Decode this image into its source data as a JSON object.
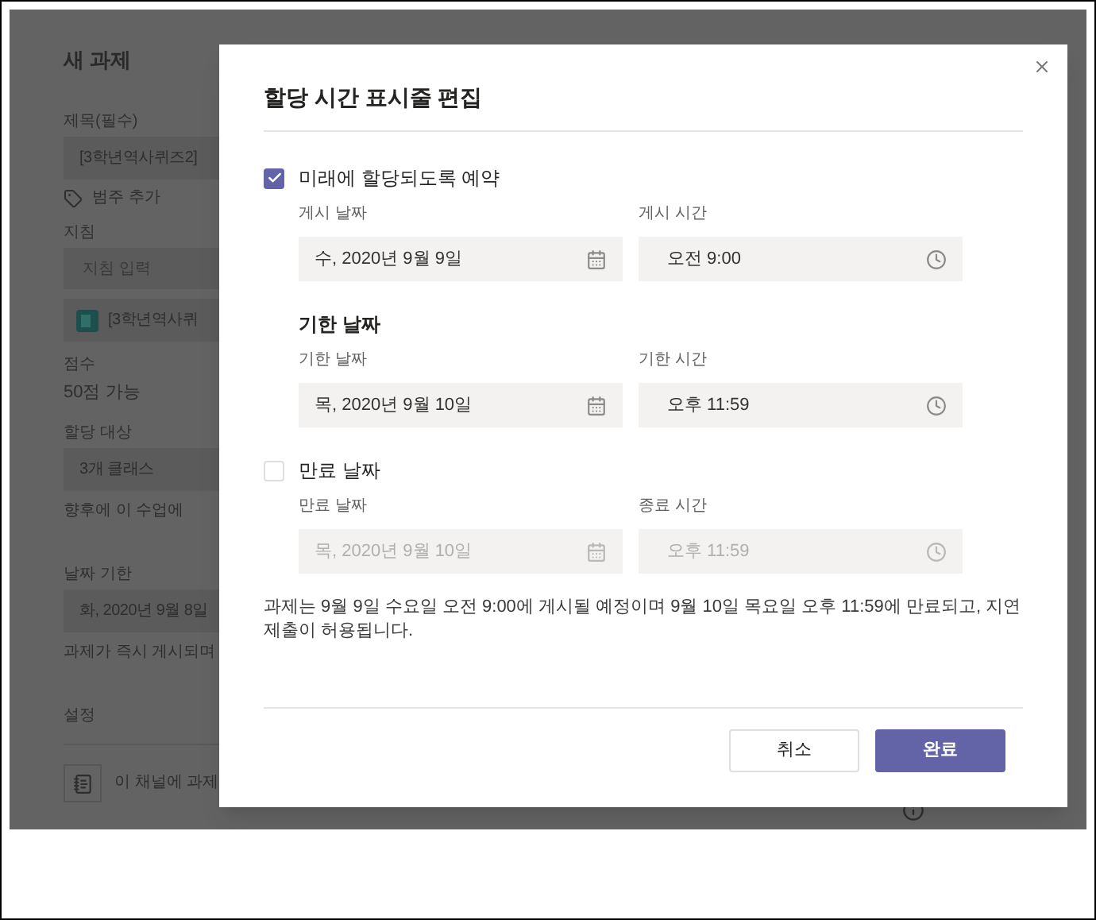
{
  "background": {
    "items": [
      {
        "kind": "heading",
        "text": "새 과제"
      },
      {
        "kind": "label",
        "text": "제목(필수)"
      },
      {
        "kind": "field",
        "text": "[3학년역사퀴즈2]"
      },
      {
        "kind": "tag",
        "text": "범주 추가"
      },
      {
        "kind": "label",
        "text": "지침"
      },
      {
        "kind": "hint",
        "placeholder": "지침 입력"
      },
      {
        "kind": "attachment",
        "text": "[3학년역사퀴"
      },
      {
        "kind": "label",
        "text": "점수"
      },
      {
        "kind": "value",
        "text": "50점 가능"
      },
      {
        "kind": "label",
        "text": "할당 대상"
      },
      {
        "kind": "field",
        "text": "3개 클래스"
      },
      {
        "kind": "note",
        "text": "향후에 이 수업에"
      },
      {
        "kind": "label",
        "text": "날짜 기한"
      },
      {
        "kind": "field",
        "text": "화, 2020년 9월 8일"
      },
      {
        "kind": "note",
        "text": "과제가 즉시 게시되며"
      },
      {
        "kind": "label",
        "text": "설정"
      },
      {
        "kind": "setting",
        "text": "이 채널에 과제"
      }
    ]
  },
  "dialog": {
    "title": "할당 시간 표시줄 편집",
    "sections": [
      {
        "kind": "checkbox",
        "title": "미래에 할당되도록 예약",
        "checked": true,
        "fields": [
          {
            "kind": "date",
            "label": "게시 날짜",
            "value": "수, 2020년 9월 9일",
            "disabled": false
          },
          {
            "kind": "time",
            "label": "게시 시간",
            "value": "오전 9:00",
            "disabled": false
          }
        ]
      },
      {
        "kind": "heading",
        "title": "기한 날짜",
        "fields": [
          {
            "kind": "date",
            "label": "기한 날짜",
            "value": "목, 2020년 9월 10일",
            "disabled": false
          },
          {
            "kind": "time",
            "label": "기한 시간",
            "value": "오후 11:59",
            "disabled": false
          }
        ]
      },
      {
        "kind": "checkbox",
        "title": "만료 날짜",
        "checked": false,
        "fields": [
          {
            "kind": "date",
            "label": "만료 날짜",
            "value": "목, 2020년 9월 10일",
            "disabled": true
          },
          {
            "kind": "time",
            "label": "종료 시간",
            "value": "오후 11:59",
            "disabled": true
          }
        ]
      }
    ],
    "summary": "과제는 9월 9일 수요일 오전 9:00에 게시될 예정이며 9월 10일 목요일 오후 11:59에 만료되고, 지연 제출이 허용됩니다.",
    "buttons": [
      {
        "kind": "secondary",
        "label": "취소"
      },
      {
        "kind": "primary",
        "label": "완료"
      }
    ]
  }
}
